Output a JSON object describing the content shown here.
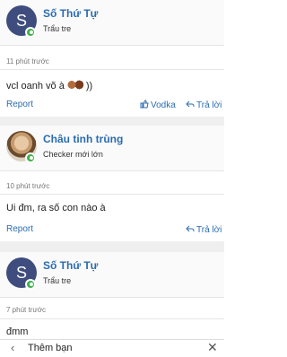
{
  "posts": [
    {
      "avatar_letter": "S",
      "username": "Số Thứ Tự",
      "role": "Trẩu tre",
      "time": "11 phút trước",
      "content_prefix": "vcl oanh võ à",
      "content_suffix": "))",
      "report_label": "Report",
      "like_label": "Vodka",
      "reply_label": "Trả lời"
    },
    {
      "avatar_letter": "",
      "username": "Châu tinh trùng",
      "role": "Checker mới lớn",
      "time": "10 phút trước",
      "content": "Ui đm, ra số con nào à",
      "report_label": "Report",
      "reply_label": "Trả lời"
    },
    {
      "avatar_letter": "S",
      "username": "Số Thứ Tự",
      "role": "Trẩu tre",
      "time": "7 phút trước",
      "content": "đmm"
    }
  ],
  "bottom_bar": {
    "title": "Thêm bạn"
  },
  "colors": {
    "link": "#2b6cb0",
    "online": "#3fb24a",
    "avatar_bg": "#3f4d7e"
  }
}
